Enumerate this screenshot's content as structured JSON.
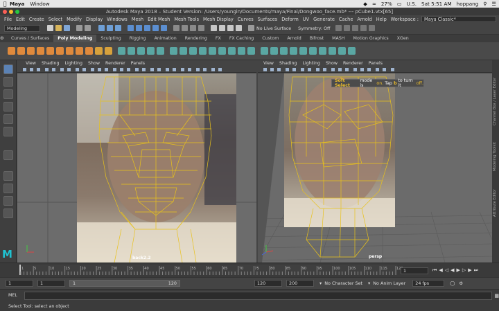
{
  "mac": {
    "app_name": "Maya",
    "menu": [
      "Window"
    ],
    "battery": "27%",
    "flag": "U.S.",
    "clock": "Sat 5:51 AM",
    "user": "hoppang"
  },
  "window_title": "Autodesk Maya 2018 – Student Version: /Users/youngin/Documents/maya/Final/Dongwoo_face.mb*   ---   pCube1.vtx[65]",
  "menubar": {
    "items": [
      "File",
      "Edit",
      "Create",
      "Select",
      "Modify",
      "Display",
      "Windows",
      "Mesh",
      "Edit Mesh",
      "Mesh Tools",
      "Mesh Display",
      "Curves",
      "Surfaces",
      "Deform",
      "UV",
      "Generate",
      "Cache",
      "Arnold",
      "Help"
    ],
    "workspace_label": "Workspace :",
    "workspace_value": "Maya Classic*"
  },
  "statusline": {
    "mode": "Modeling",
    "live_surface": "No Live Surface",
    "symmetry": "Symmetry: Off"
  },
  "shelf": {
    "tabs": [
      "Curves / Surfaces",
      "Poly Modeling",
      "Sculpting",
      "Rigging",
      "Animation",
      "Rendering",
      "FX",
      "FX Caching",
      "Custom",
      "Arnold",
      "Bifrost",
      "MASH",
      "Motion Graphics",
      "XGen"
    ],
    "active_tab": "Poly Modeling"
  },
  "panels": {
    "menu": [
      "View",
      "Shading",
      "Lighting",
      "Show",
      "Renderer",
      "Panels"
    ],
    "left_camera": "back2.2",
    "right_camera": "persp"
  },
  "tooltip": {
    "part1": "Soft Select",
    "part2": "mode is",
    "part3": "on.",
    "part4": "Tap",
    "part5": "b",
    "part6": "to turn it",
    "part7": "off."
  },
  "right_strip": [
    "Channel Box / Layer Editor",
    "Modeling Toolkit",
    "Attribute Editor"
  ],
  "timeline": {
    "ticks": [
      "1",
      "5",
      "10",
      "15",
      "20",
      "25",
      "30",
      "35",
      "40",
      "45",
      "50",
      "55",
      "60",
      "65",
      "70",
      "75",
      "80",
      "85",
      "90",
      "95",
      "100",
      "105",
      "110",
      "115",
      "120"
    ],
    "current_frame": "1"
  },
  "range": {
    "start": "1",
    "start2": "1",
    "slider_start": "1",
    "slider_end": "120",
    "end1": "120",
    "end2": "200",
    "character_set": "No Character Set",
    "anim_layer": "No Anim Layer",
    "fps": "24 fps"
  },
  "command": {
    "label": "MEL",
    "value": ""
  },
  "help_line": "Select Tool: select an object"
}
